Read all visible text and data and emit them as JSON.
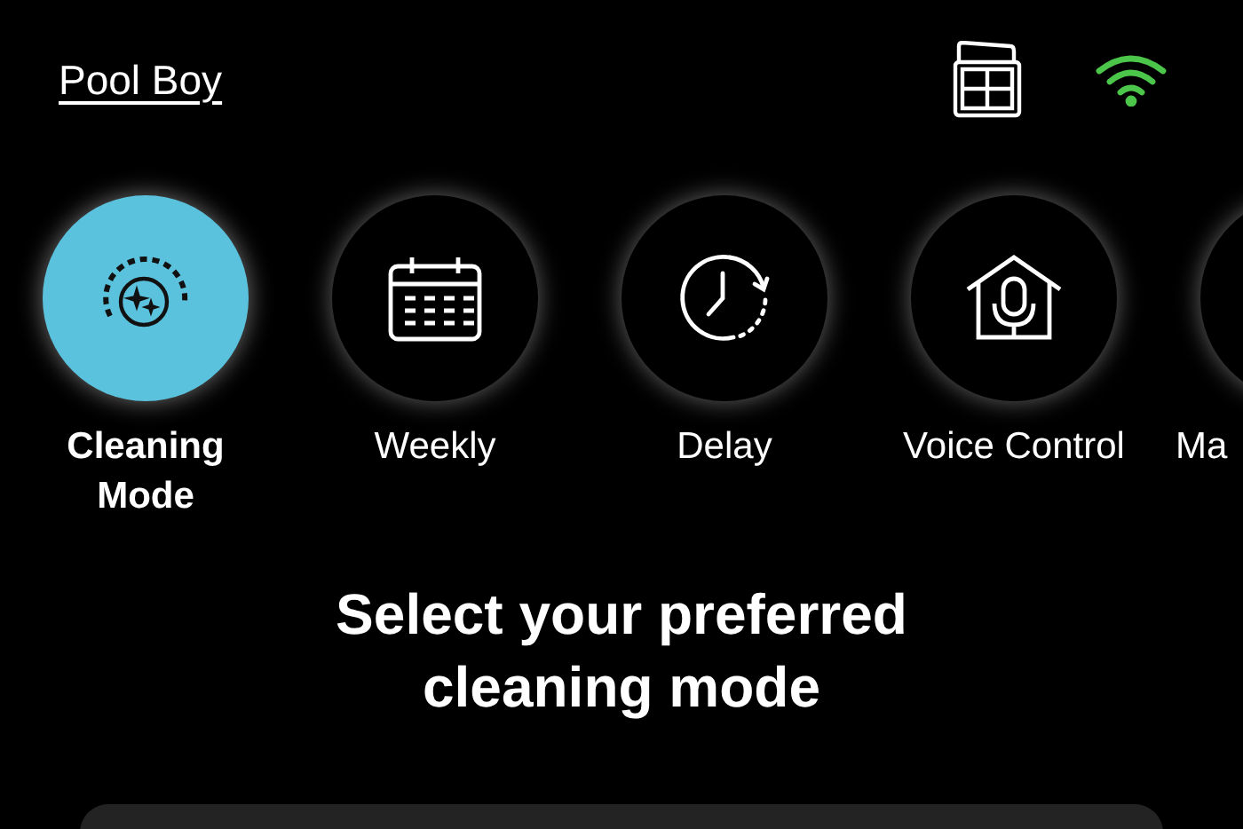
{
  "header": {
    "title": "Pool Boy"
  },
  "modes": [
    {
      "label": "Cleaning Mode",
      "selected": true,
      "kind": "cleaning"
    },
    {
      "label": "Weekly",
      "selected": false,
      "kind": "calendar"
    },
    {
      "label": "Delay",
      "selected": false,
      "kind": "delay"
    },
    {
      "label": "Voice Control",
      "selected": false,
      "kind": "voice"
    },
    {
      "label": "Ma",
      "selected": false,
      "kind": "partial"
    }
  ],
  "heading": "Select your preferred cleaning mode"
}
